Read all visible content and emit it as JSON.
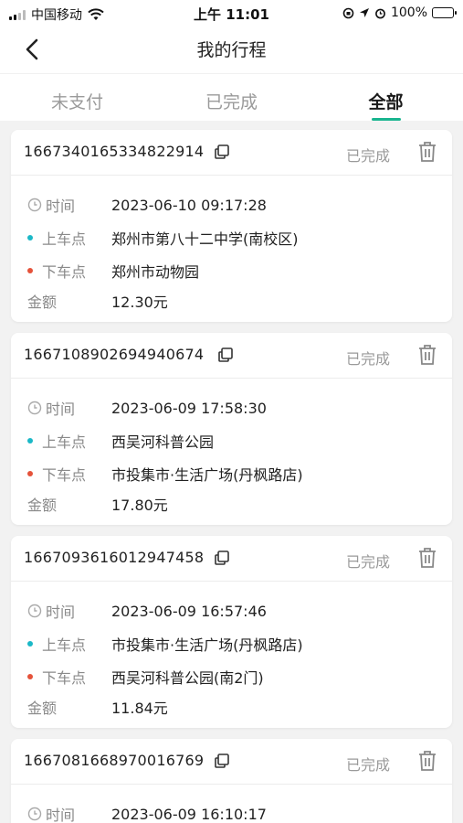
{
  "status_bar": {
    "carrier": "中国移动",
    "time": "上午 11:01",
    "battery": "100%",
    "battery_color": "#3cc14a"
  },
  "nav": {
    "title": "我的行程",
    "back_icon": "chevron-left-icon"
  },
  "tabs": [
    {
      "label": "未支付",
      "active": false
    },
    {
      "label": "已完成",
      "active": false
    },
    {
      "label": "全部",
      "active": true
    }
  ],
  "colors": {
    "accent": "#19b58f",
    "pickup_dot": "#1bb8c7",
    "dropoff_dot": "#e5523a"
  },
  "labels": {
    "time": "时间",
    "pickup": "上车点",
    "dropoff": "下车点",
    "amount": "金额"
  },
  "orders": [
    {
      "id": "1667340165334822914",
      "status": "已完成",
      "time": "2023-06-10 09:17:28",
      "pickup": "郑州市第八十二中学(南校区)",
      "dropoff": "郑州市动物园",
      "amount": "12.30元"
    },
    {
      "id": "1667108902694940674",
      "status": "已完成",
      "time": "2023-06-09 17:58:30",
      "pickup": "西吴河科普公园",
      "dropoff": "市投集市·生活广场(丹枫路店)",
      "amount": "17.80元"
    },
    {
      "id": "1667093616012947458",
      "status": "已完成",
      "time": "2023-06-09 16:57:46",
      "pickup": "市投集市·生活广场(丹枫路店)",
      "dropoff": "西吴河科普公园(南2门)",
      "amount": "11.84元"
    },
    {
      "id": "1667081668970016769",
      "status": "已完成",
      "time": "2023-06-09 16:10:17",
      "pickup": "",
      "dropoff": "",
      "amount": ""
    }
  ]
}
